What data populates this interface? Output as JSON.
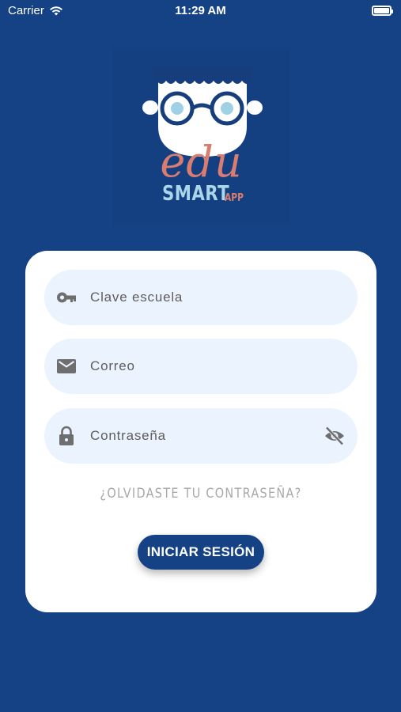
{
  "status_bar": {
    "carrier": "Carrier",
    "time": "11:29 AM",
    "battery_level": 1.0
  },
  "logo": {
    "word_main": "edu",
    "word_secondary": "SMART",
    "word_suffix": "APP",
    "colors": {
      "background": "#143f80",
      "edu": "#d97d70",
      "smart": "#a9d6e8"
    }
  },
  "form": {
    "school_key": {
      "placeholder": "Clave escuela",
      "value": "",
      "icon": "key-icon"
    },
    "email": {
      "placeholder": "Correo",
      "value": "",
      "icon": "envelope-icon"
    },
    "password": {
      "placeholder": "Contraseña",
      "value": "",
      "icon": "lock-icon",
      "toggle_icon": "eye-off-icon"
    },
    "forgot_password": "¿Olvidaste tu contraseña?",
    "submit_label": "INICIAR SESIÓN"
  },
  "colors": {
    "background": "#154284",
    "card": "#ffffff",
    "field": "#ebf3fe",
    "icon": "#6e6e6e",
    "muted_text": "#a9a9a9"
  }
}
